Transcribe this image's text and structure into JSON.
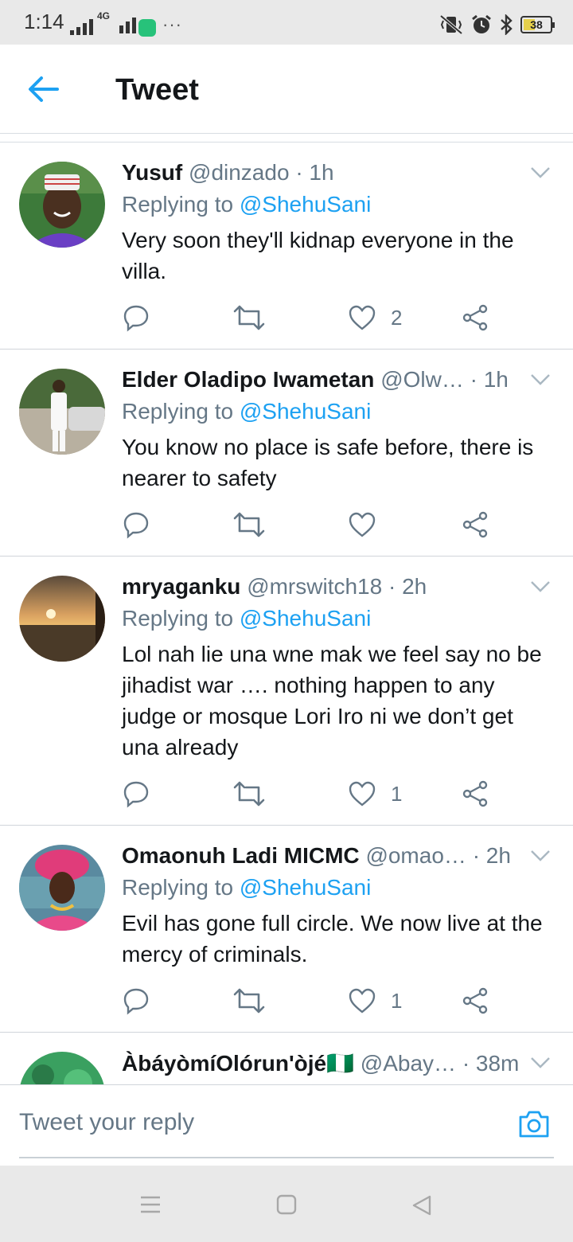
{
  "status_bar": {
    "time": "1:14",
    "network": "4G",
    "battery": "38"
  },
  "header": {
    "title": "Tweet"
  },
  "tweets": [
    {
      "name": "Yusuf",
      "handle": "@dinzado",
      "time": "· 1h",
      "replying_label": "Replying to",
      "replying_to": "@ShehuSani",
      "text": "Very soon they'll kidnap everyone in the villa.",
      "likes": "2"
    },
    {
      "name": "Elder Oladipo Iwametan",
      "handle": "@Olw…",
      "time": "· 1h",
      "replying_label": "Replying to",
      "replying_to": "@ShehuSani",
      "text": "You know no place is safe before, there is nearer to safety",
      "likes": ""
    },
    {
      "name": "mryaganku",
      "handle": "@mrswitch18",
      "time": "· 2h",
      "replying_label": "Replying to",
      "replying_to": "@ShehuSani",
      "text": "Lol nah lie una wne mak we feel say no be jihadist war …. nothing happen to any judge or mosque Lori Iro ni we don’t get una already",
      "likes": "1"
    },
    {
      "name": "Omaonuh Ladi MICMC",
      "handle": "@omao…",
      "time": "· 2h",
      "replying_label": "Replying to",
      "replying_to": "@ShehuSani",
      "text": "Evil has gone full circle. We now live at the mercy of criminals.",
      "likes": "1"
    },
    {
      "name": "ÀbáyòmíOlórun'òjé🇳🇬",
      "handle": "@Abay…",
      "time": "· 38m"
    }
  ],
  "reply_bar": {
    "placeholder": "Tweet your reply"
  },
  "colors": {
    "accent": "#1da1f2",
    "secondary_text": "#657786",
    "primary_text": "#14171a"
  }
}
